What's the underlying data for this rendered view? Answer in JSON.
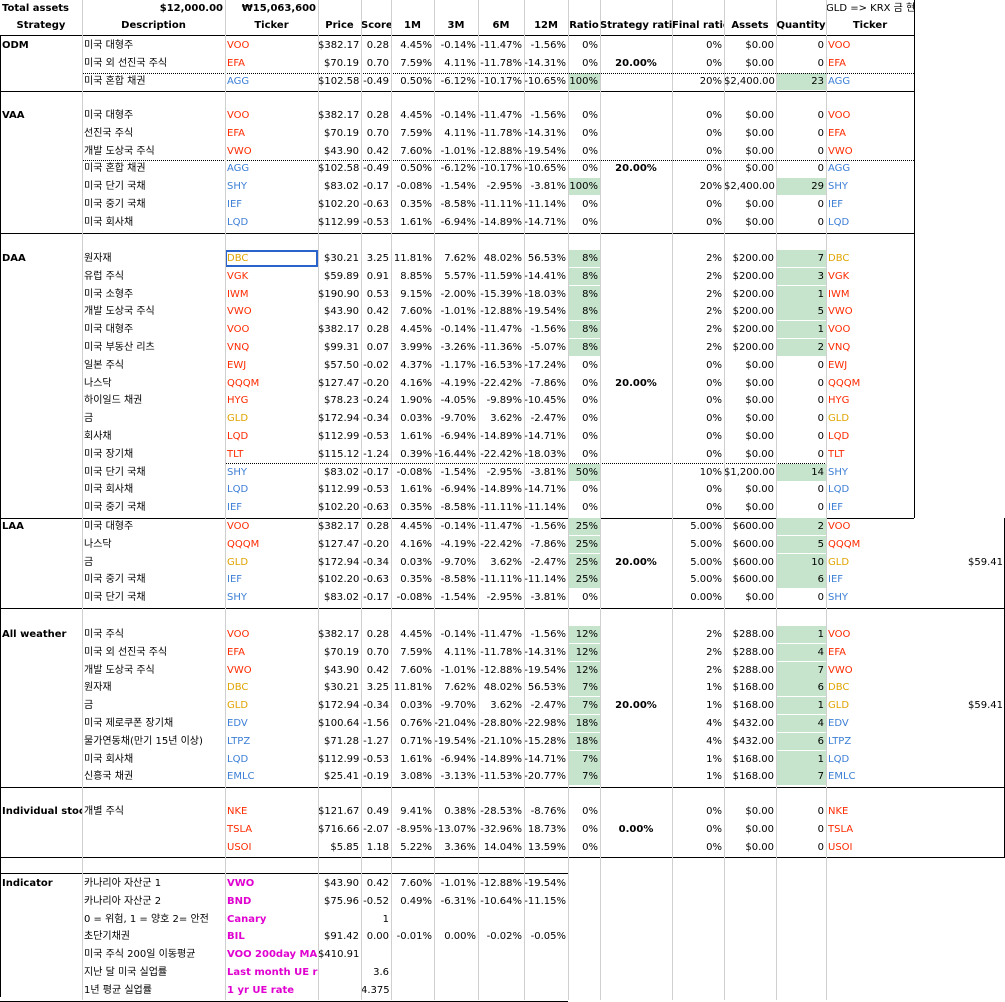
{
  "top": {
    "total_assets_label": "Total assets",
    "usd": "$12,000.00",
    "krw": "₩15,063,600",
    "note": "GLD => KRX 금 현물"
  },
  "headers": [
    "Strategy",
    "Description",
    "Ticker",
    "Price",
    "Score",
    "1M",
    "3M",
    "6M",
    "12M",
    "Ratio",
    "Strategy ratio",
    "Final ratio",
    "Assets",
    "Quantity",
    "Ticker"
  ],
  "colors": {
    "us_ticker_red": "#ff2a00",
    "bond_blue": "#3d7fd6",
    "commodity_orange": "#e0a400",
    "indicator_magenta": "#e000d0",
    "highlight_green": "#c6e3cc"
  },
  "sections": [
    {
      "name": "ODM",
      "strategy_ratio": "20.00%",
      "rows": [
        [
          "미국 대형주",
          "VOO",
          "$382.17",
          "0.28",
          "4.45%",
          "-0.14%",
          "-11.47%",
          "-1.56%",
          "0%",
          "0%",
          "$0.00",
          "0",
          "VOO",
          "red",
          false
        ],
        [
          "미국 외 선진국 주식",
          "EFA",
          "$70.19",
          "0.70",
          "7.59%",
          "4.11%",
          "-11.78%",
          "-14.31%",
          "0%",
          "0%",
          "$0.00",
          "0",
          "EFA",
          "red",
          false
        ],
        [
          "미국 혼합 채권",
          "AGG",
          "$102.58",
          "-0.49",
          "0.50%",
          "-6.12%",
          "-10.17%",
          "-10.65%",
          "100%",
          "20%",
          "$2,400.00",
          "23",
          "AGG",
          "blue",
          true
        ]
      ]
    },
    {
      "name": "VAA",
      "strategy_ratio": "20.00%",
      "rows": [
        [
          "미국 대형주",
          "VOO",
          "$382.17",
          "0.28",
          "4.45%",
          "-0.14%",
          "-11.47%",
          "-1.56%",
          "0%",
          "0%",
          "$0.00",
          "0",
          "VOO",
          "red",
          false
        ],
        [
          "선진국 주식",
          "EFA",
          "$70.19",
          "0.70",
          "7.59%",
          "4.11%",
          "-11.78%",
          "-14.31%",
          "0%",
          "0%",
          "$0.00",
          "0",
          "EFA",
          "red",
          false
        ],
        [
          "개발 도상국 주식",
          "VWO",
          "$43.90",
          "0.42",
          "7.60%",
          "-1.01%",
          "-12.88%",
          "-19.54%",
          "0%",
          "0%",
          "$0.00",
          "0",
          "VWO",
          "red",
          false
        ],
        [
          "미국 혼합 채권",
          "AGG",
          "$102.58",
          "-0.49",
          "0.50%",
          "-6.12%",
          "-10.17%",
          "-10.65%",
          "0%",
          "0%",
          "$0.00",
          "0",
          "AGG",
          "blue",
          false
        ],
        [
          "미국 단기 국채",
          "SHY",
          "$83.02",
          "-0.17",
          "-0.08%",
          "-1.54%",
          "-2.95%",
          "-3.81%",
          "100%",
          "20%",
          "$2,400.00",
          "29",
          "SHY",
          "blue",
          true
        ],
        [
          "미국 중기 국채",
          "IEF",
          "$102.20",
          "-0.63",
          "0.35%",
          "-8.58%",
          "-11.11%",
          "-11.14%",
          "0%",
          "0%",
          "$0.00",
          "0",
          "IEF",
          "blue",
          false
        ],
        [
          "미국 회사채",
          "LQD",
          "$112.99",
          "-0.53",
          "1.61%",
          "-6.94%",
          "-14.89%",
          "-14.71%",
          "0%",
          "0%",
          "$0.00",
          "0",
          "LQD",
          "blue",
          false
        ]
      ]
    },
    {
      "name": "DAA",
      "strategy_ratio": "20.00%",
      "rows": [
        [
          "원자재",
          "DBC",
          "$30.21",
          "3.25",
          "11.81%",
          "7.62%",
          "48.02%",
          "56.53%",
          "8%",
          "2%",
          "$200.00",
          "7",
          "DBC",
          "orange",
          true
        ],
        [
          "유럽 주식",
          "VGK",
          "$59.89",
          "0.91",
          "8.85%",
          "5.57%",
          "-11.59%",
          "-14.41%",
          "8%",
          "2%",
          "$200.00",
          "3",
          "VGK",
          "red",
          true
        ],
        [
          "미국 소형주",
          "IWM",
          "$190.90",
          "0.53",
          "9.15%",
          "-2.00%",
          "-15.39%",
          "-18.03%",
          "8%",
          "2%",
          "$200.00",
          "1",
          "IWM",
          "red",
          true
        ],
        [
          "개발 도상국 주식",
          "VWO",
          "$43.90",
          "0.42",
          "7.60%",
          "-1.01%",
          "-12.88%",
          "-19.54%",
          "8%",
          "2%",
          "$200.00",
          "5",
          "VWO",
          "red",
          true
        ],
        [
          "미국 대형주",
          "VOO",
          "$382.17",
          "0.28",
          "4.45%",
          "-0.14%",
          "-11.47%",
          "-1.56%",
          "8%",
          "2%",
          "$200.00",
          "1",
          "VOO",
          "red",
          true
        ],
        [
          "미국 부동산 리츠",
          "VNQ",
          "$99.31",
          "0.07",
          "3.99%",
          "-3.26%",
          "-11.36%",
          "-5.07%",
          "8%",
          "2%",
          "$200.00",
          "2",
          "VNQ",
          "red",
          true
        ],
        [
          "일본 주식",
          "EWJ",
          "$57.50",
          "-0.02",
          "4.37%",
          "-1.17%",
          "-16.53%",
          "-17.24%",
          "0%",
          "0%",
          "$0.00",
          "0",
          "EWJ",
          "red",
          false
        ],
        [
          "나스닥",
          "QQQM",
          "$127.47",
          "-0.20",
          "4.16%",
          "-4.19%",
          "-22.42%",
          "-7.86%",
          "0%",
          "0%",
          "$0.00",
          "0",
          "QQQM",
          "red",
          false
        ],
        [
          "하이일드 채권",
          "HYG",
          "$78.23",
          "-0.24",
          "1.90%",
          "-4.05%",
          "-9.89%",
          "-10.45%",
          "0%",
          "0%",
          "$0.00",
          "0",
          "HYG",
          "red",
          false
        ],
        [
          "금",
          "GLD",
          "$172.94",
          "-0.34",
          "0.03%",
          "-9.70%",
          "3.62%",
          "-2.47%",
          "0%",
          "0%",
          "$0.00",
          "0",
          "GLD",
          "orange",
          false
        ],
        [
          "회사채",
          "LQD",
          "$112.99",
          "-0.53",
          "1.61%",
          "-6.94%",
          "-14.89%",
          "-14.71%",
          "0%",
          "0%",
          "$0.00",
          "0",
          "LQD",
          "red",
          false
        ],
        [
          "미국 장기채",
          "TLT",
          "$115.12",
          "-1.24",
          "0.39%",
          "-16.44%",
          "-22.42%",
          "-18.03%",
          "0%",
          "0%",
          "$0.00",
          "0",
          "TLT",
          "red",
          false
        ],
        [
          "미국 단기 국채",
          "SHY",
          "$83.02",
          "-0.17",
          "-0.08%",
          "-1.54%",
          "-2.95%",
          "-3.81%",
          "50%",
          "10%",
          "$1,200.00",
          "14",
          "SHY",
          "blue",
          true
        ],
        [
          "미국 회사채",
          "LQD",
          "$112.99",
          "-0.53",
          "1.61%",
          "-6.94%",
          "-14.89%",
          "-14.71%",
          "0%",
          "0%",
          "$0.00",
          "0",
          "LQD",
          "blue",
          false
        ],
        [
          "미국 중기 국채",
          "IEF",
          "$102.20",
          "-0.63",
          "0.35%",
          "-8.58%",
          "-11.11%",
          "-11.14%",
          "0%",
          "0%",
          "$0.00",
          "0",
          "IEF",
          "blue",
          false
        ]
      ]
    },
    {
      "name": "LAA",
      "strategy_ratio": "20.00%",
      "side_value": "$59.41",
      "rows": [
        [
          "미국 대형주",
          "VOO",
          "$382.17",
          "0.28",
          "4.45%",
          "-0.14%",
          "-11.47%",
          "-1.56%",
          "25%",
          "5.00%",
          "$600.00",
          "2",
          "VOO",
          "red",
          true
        ],
        [
          "나스닥",
          "QQQM",
          "$127.47",
          "-0.20",
          "4.16%",
          "-4.19%",
          "-22.42%",
          "-7.86%",
          "25%",
          "5.00%",
          "$600.00",
          "5",
          "QQQM",
          "red",
          true
        ],
        [
          "금",
          "GLD",
          "$172.94",
          "-0.34",
          "0.03%",
          "-9.70%",
          "3.62%",
          "-2.47%",
          "25%",
          "5.00%",
          "$600.00",
          "10",
          "GLD",
          "orange",
          true
        ],
        [
          "미국 중기 국채",
          "IEF",
          "$102.20",
          "-0.63",
          "0.35%",
          "-8.58%",
          "-11.11%",
          "-11.14%",
          "25%",
          "5.00%",
          "$600.00",
          "6",
          "IEF",
          "blue",
          true
        ],
        [
          "미국 단기 국채",
          "SHY",
          "$83.02",
          "-0.17",
          "-0.08%",
          "-1.54%",
          "-2.95%",
          "-3.81%",
          "0%",
          "0.00%",
          "$0.00",
          "0",
          "SHY",
          "blue",
          false
        ]
      ]
    },
    {
      "name": "All weather",
      "strategy_ratio": "20.00%",
      "side_value": "$59.41",
      "rows": [
        [
          "미국 주식",
          "VOO",
          "$382.17",
          "0.28",
          "4.45%",
          "-0.14%",
          "-11.47%",
          "-1.56%",
          "12%",
          "2%",
          "$288.00",
          "1",
          "VOO",
          "red",
          true
        ],
        [
          "미국 외 선진국 주식",
          "EFA",
          "$70.19",
          "0.70",
          "7.59%",
          "4.11%",
          "-11.78%",
          "-14.31%",
          "12%",
          "2%",
          "$288.00",
          "4",
          "EFA",
          "red",
          true
        ],
        [
          "개발 도상국 주식",
          "VWO",
          "$43.90",
          "0.42",
          "7.60%",
          "-1.01%",
          "-12.88%",
          "-19.54%",
          "12%",
          "2%",
          "$288.00",
          "7",
          "VWO",
          "red",
          true
        ],
        [
          "원자재",
          "DBC",
          "$30.21",
          "3.25",
          "11.81%",
          "7.62%",
          "48.02%",
          "56.53%",
          "7%",
          "1%",
          "$168.00",
          "6",
          "DBC",
          "orange",
          true
        ],
        [
          "금",
          "GLD",
          "$172.94",
          "-0.34",
          "0.03%",
          "-9.70%",
          "3.62%",
          "-2.47%",
          "7%",
          "1%",
          "$168.00",
          "1",
          "GLD",
          "orange",
          true
        ],
        [
          "미국 제로쿠폰 장기채",
          "EDV",
          "$100.64",
          "-1.56",
          "0.76%",
          "-21.04%",
          "-28.80%",
          "-22.98%",
          "18%",
          "4%",
          "$432.00",
          "4",
          "EDV",
          "blue",
          true
        ],
        [
          "물가연동채(만기 15년 이상)",
          "LTPZ",
          "$71.28",
          "-1.27",
          "0.71%",
          "-19.54%",
          "-21.10%",
          "-15.28%",
          "18%",
          "4%",
          "$432.00",
          "6",
          "LTPZ",
          "blue",
          true
        ],
        [
          "미국 회사채",
          "LQD",
          "$112.99",
          "-0.53",
          "1.61%",
          "-6.94%",
          "-14.89%",
          "-14.71%",
          "7%",
          "1%",
          "$168.00",
          "1",
          "LQD",
          "blue",
          true
        ],
        [
          "신흥국 채권",
          "EMLC",
          "$25.41",
          "-0.19",
          "3.08%",
          "-3.13%",
          "-11.53%",
          "-20.77%",
          "7%",
          "1%",
          "$168.00",
          "7",
          "EMLC",
          "blue",
          true
        ]
      ]
    },
    {
      "name": "Individual stock",
      "strategy_ratio": "0.00%",
      "rows": [
        [
          "개별 주식",
          "NKE",
          "$121.67",
          "0.49",
          "9.41%",
          "0.38%",
          "-28.53%",
          "-8.76%",
          "0%",
          "0%",
          "$0.00",
          "0",
          "NKE",
          "red",
          false
        ],
        [
          "",
          "TSLA",
          "$716.66",
          "-2.07",
          "-8.95%",
          "-13.07%",
          "-32.96%",
          "18.73%",
          "0%",
          "0%",
          "$0.00",
          "0",
          "TSLA",
          "red",
          false
        ],
        [
          "",
          "USOI",
          "$5.85",
          "1.18",
          "5.22%",
          "3.36%",
          "14.04%",
          "13.59%",
          "0%",
          "0%",
          "$0.00",
          "0",
          "USOI",
          "red",
          false
        ]
      ]
    }
  ],
  "indicator": {
    "name": "Indicator",
    "rows": [
      [
        "카나리아 자산군 1",
        "VWO",
        "$43.90",
        "0.42",
        "7.60%",
        "-1.01%",
        "-12.88%",
        "-19.54%"
      ],
      [
        "카나리아 자산군 2",
        "BND",
        "$75.96",
        "-0.52",
        "0.49%",
        "-6.31%",
        "-10.64%",
        "-11.15%"
      ],
      [
        "0 = 위험, 1 = 양호 2= 안전",
        "Canary",
        "",
        "1",
        "",
        "",
        "",
        ""
      ],
      [
        "초단기채권",
        "BIL",
        "$91.42",
        "0.00",
        "-0.01%",
        "0.00%",
        "-0.02%",
        "-0.05%"
      ],
      [
        "미국 주식 200일 이동평균",
        "VOO 200day MA",
        "$410.91",
        "",
        "",
        "",
        "",
        ""
      ],
      [
        "지난 달 미국 실업률",
        "Last month UE rate",
        "",
        "3.6",
        "",
        "",
        "",
        ""
      ],
      [
        "1년 평균 실업률",
        "1 yr UE rate",
        "",
        "4.375",
        "",
        "",
        "",
        ""
      ]
    ]
  }
}
